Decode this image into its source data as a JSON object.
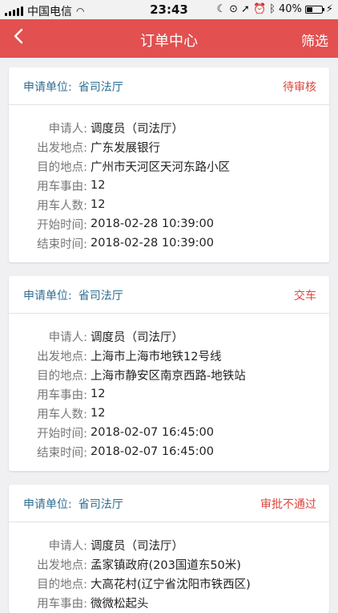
{
  "status_bar": {
    "carrier": "中国电信",
    "time": "23:43",
    "battery": "40%",
    "battery_level": 0.4
  },
  "navbar": {
    "back_icon": "chevron-left-icon",
    "title": "订单中心",
    "filter_label": "筛选"
  },
  "orders": [
    {
      "unit_label": "申请单位:",
      "unit_value": "省司法厅",
      "status": "待审核",
      "fields": [
        {
          "label": "申请人:",
          "value": "调度员（司法厅）"
        },
        {
          "label": "出发地点:",
          "value": "广东发展银行"
        },
        {
          "label": "目的地点:",
          "value": "广州市天河区天河东路小区"
        },
        {
          "label": "用车事由:",
          "value": "12"
        },
        {
          "label": "用车人数:",
          "value": "12"
        },
        {
          "label": "开始时间:",
          "value": "2018-02-28 10:39:00"
        },
        {
          "label": "结束时间:",
          "value": "2018-02-28 10:39:00"
        }
      ]
    },
    {
      "unit_label": "申请单位:",
      "unit_value": "省司法厅",
      "status": "交车",
      "fields": [
        {
          "label": "申请人:",
          "value": "调度员（司法厅）"
        },
        {
          "label": "出发地点:",
          "value": "上海市上海市地铁12号线"
        },
        {
          "label": "目的地点:",
          "value": "上海市静安区南京西路-地铁站"
        },
        {
          "label": "用车事由:",
          "value": "12"
        },
        {
          "label": "用车人数:",
          "value": "12"
        },
        {
          "label": "开始时间:",
          "value": "2018-02-07 16:45:00"
        },
        {
          "label": "结束时间:",
          "value": "2018-02-07 16:45:00"
        }
      ]
    },
    {
      "unit_label": "申请单位:",
      "unit_value": "省司法厅",
      "status": "审批不通过",
      "fields": [
        {
          "label": "申请人:",
          "value": "调度员（司法厅）"
        },
        {
          "label": "出发地点:",
          "value": "孟家镇政府(203国道东50米)"
        },
        {
          "label": "目的地点:",
          "value": "大高花村(辽宁省沈阳市铁西区)"
        },
        {
          "label": "用车事由:",
          "value": "微微松起头"
        }
      ]
    }
  ]
}
